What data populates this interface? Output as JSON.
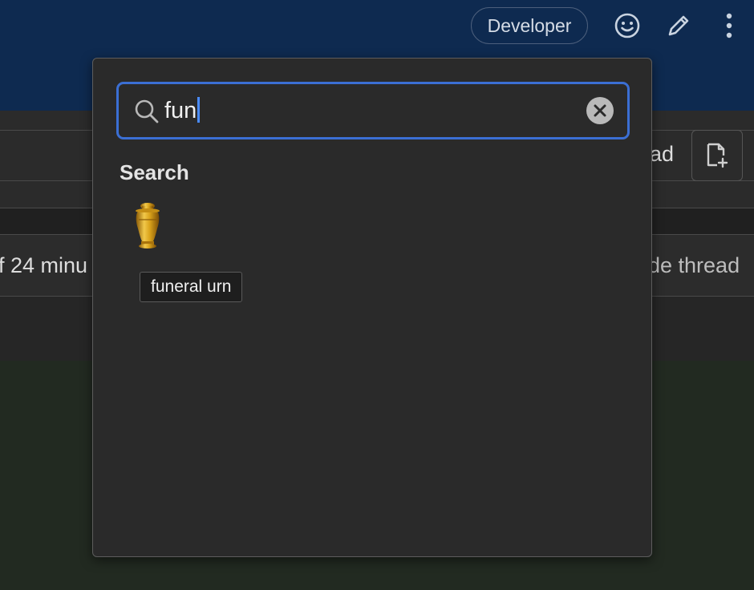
{
  "header": {
    "role_badge": "Developer",
    "icons": [
      "smiley-icon",
      "pencil-icon",
      "more-vertical-icon"
    ]
  },
  "background": {
    "thread_button_partial": "ad",
    "time_text_partial": "f 24 minu",
    "hide_thread_partial": "de thread"
  },
  "emoji_picker": {
    "search": {
      "value": "fun",
      "placeholder": ""
    },
    "section_title": "Search",
    "results": [
      {
        "emoji": "⚱️",
        "name": "funeral urn"
      }
    ],
    "tooltip": "funeral urn"
  },
  "colors": {
    "header_bg": "#0e2a50",
    "popover_bg": "#2a2a2a",
    "focus_ring": "#3b6fd4",
    "urn_gold": "#d9a21a"
  }
}
